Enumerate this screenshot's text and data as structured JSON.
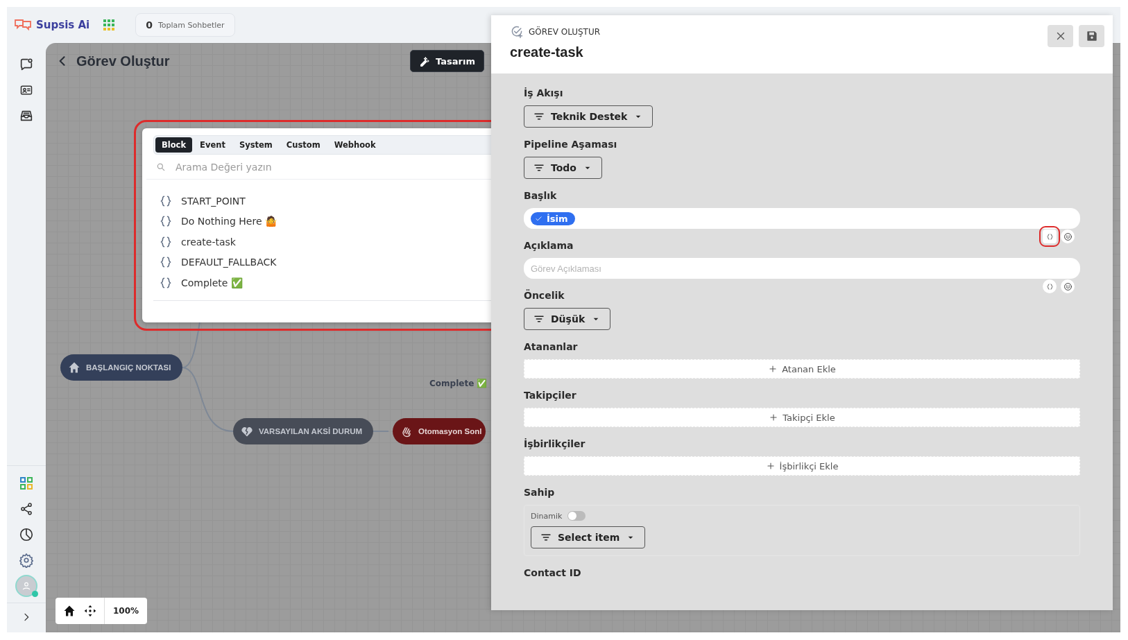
{
  "brand": {
    "name": "Supsis Ai"
  },
  "stats": {
    "count": "0",
    "label": "Toplam Sohbetler"
  },
  "page": {
    "title": "Görev Oluştur",
    "design_button": "Tasarım"
  },
  "nodes": [
    {
      "kind": "start",
      "label": "BAŞLANGIÇ NOKTASI"
    },
    {
      "kind": "fallback",
      "label": "VARSAYILAN AKSİ DURUM"
    },
    {
      "kind": "end",
      "label": "Otomasyon Sonl"
    }
  ],
  "edge_label": "Complete ✅",
  "zoom": "100%",
  "picker": {
    "highlighted": true,
    "tabs": [
      {
        "label": "Block",
        "selected": true
      },
      {
        "label": "Event",
        "selected": false
      },
      {
        "label": "System",
        "selected": false
      },
      {
        "label": "Custom",
        "selected": false
      },
      {
        "label": "Webhook",
        "selected": false
      }
    ],
    "search": {
      "placeholder": "Arama Değeri yazın"
    },
    "items": [
      "START_POINT",
      "Do Nothing Here 🤷",
      "create-task",
      "DEFAULT_FALLBACK",
      "Complete ✅"
    ]
  },
  "panel": {
    "kicker": "GÖREV OLUŞTUR",
    "title": "create-task",
    "fields": [
      {
        "kind": "dropdown",
        "label": "İş Akışı",
        "value": "Teknik Destek"
      },
      {
        "kind": "dropdown",
        "label": "Pipeline Aşaması",
        "value": "Todo"
      },
      {
        "kind": "chips",
        "label": "Başlık",
        "chip": "İsim",
        "variable_highlighted": true
      },
      {
        "kind": "text",
        "label": "Açıklama",
        "placeholder": "Görev Açıklaması",
        "variable_highlighted": false
      },
      {
        "kind": "dropdown",
        "label": "Öncelik",
        "value": "Düşük"
      },
      {
        "kind": "add",
        "label": "Atananlar",
        "button": "Atanan Ekle"
      },
      {
        "kind": "add",
        "label": "Takipçiler",
        "button": "Takipçi Ekle"
      },
      {
        "kind": "add",
        "label": "İşbirlikçiler",
        "button": "İşbirlikçi Ekle"
      },
      {
        "kind": "owner",
        "label": "Sahip",
        "toggle": {
          "label": "Dinamik",
          "on": false
        },
        "value": "Select item"
      },
      {
        "kind": "heading",
        "label": "Contact ID"
      }
    ]
  }
}
